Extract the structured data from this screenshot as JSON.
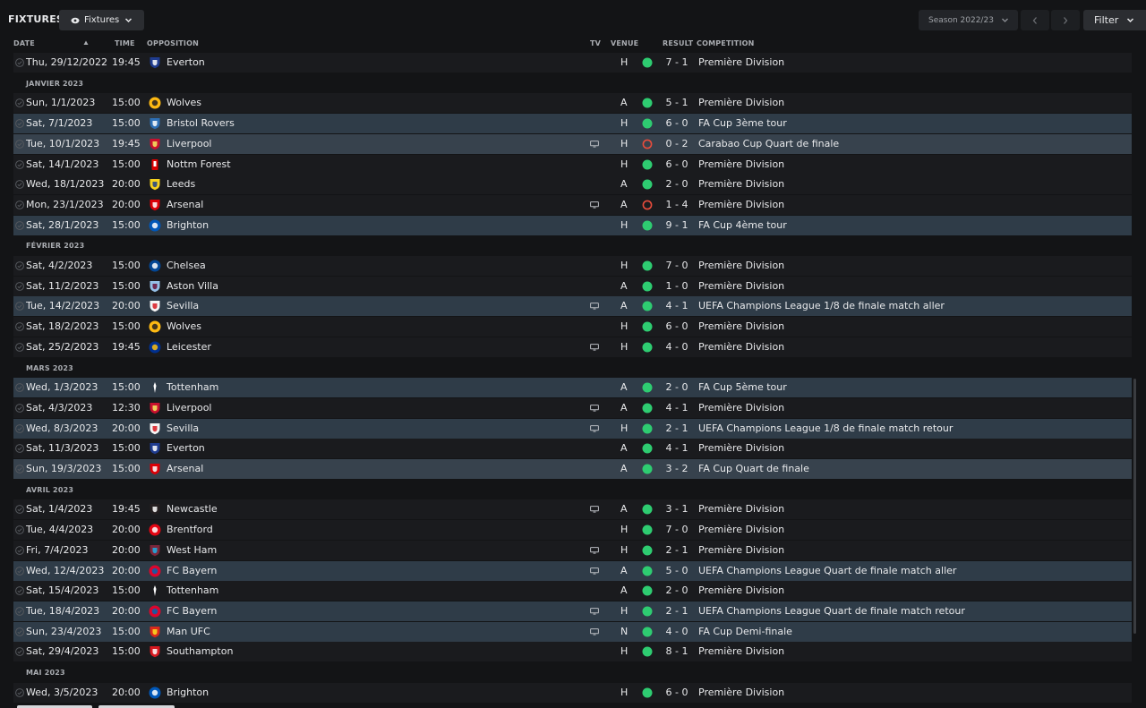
{
  "header": {
    "title": "FIXTURES",
    "view_label": "Fixtures",
    "season_label": "Season 2022/23",
    "filter_label": "Filter"
  },
  "columns": {
    "date": "DATE",
    "time": "TIME",
    "opposition": "OPPOSITION",
    "tv": "TV",
    "venue": "VENUE",
    "result": "RESULT",
    "competition": "COMPETITION"
  },
  "colors": {
    "win": "#2ecc71",
    "loss": "#e74c3c",
    "highlight_row": "#2f3c48",
    "selected_row": "#37424d"
  },
  "sections": [
    {
      "label": "JANVIER 2023"
    },
    {
      "label": "FÉVRIER 2023"
    },
    {
      "label": "MARS 2023"
    },
    {
      "label": "AVRIL 2023"
    },
    {
      "label": "MAI 2023"
    }
  ],
  "fixtures": [
    {
      "date": "Thu, 29/12/2022",
      "time": "19:45",
      "opp": "Everton",
      "crest": "everton-crest-icon",
      "tv": false,
      "venue": "H",
      "outcome": "win",
      "result": "7 - 1",
      "comp": "Première Division",
      "row": "normal"
    },
    {
      "date": "Sun, 1/1/2023",
      "time": "15:00",
      "opp": "Wolves",
      "crest": "wolves-crest-icon",
      "tv": false,
      "venue": "A",
      "outcome": "win",
      "result": "5 - 1",
      "comp": "Première Division",
      "row": "normal"
    },
    {
      "date": "Sat, 7/1/2023",
      "time": "15:00",
      "opp": "Bristol Rovers",
      "crest": "bristol-rovers-crest-icon",
      "tv": false,
      "venue": "H",
      "outcome": "win",
      "result": "6 - 0",
      "comp": "FA Cup 3ème tour",
      "row": "hl"
    },
    {
      "date": "Tue, 10/1/2023",
      "time": "19:45",
      "opp": "Liverpool",
      "crest": "liverpool-crest-icon",
      "tv": true,
      "venue": "H",
      "outcome": "loss",
      "result": "0 - 2",
      "comp": "Carabao Cup Quart de finale",
      "row": "sel"
    },
    {
      "date": "Sat, 14/1/2023",
      "time": "15:00",
      "opp": "Nottm Forest",
      "crest": "nottm-forest-crest-icon",
      "tv": false,
      "venue": "H",
      "outcome": "win",
      "result": "6 - 0",
      "comp": "Première Division",
      "row": "normal"
    },
    {
      "date": "Wed, 18/1/2023",
      "time": "20:00",
      "opp": "Leeds",
      "crest": "leeds-crest-icon",
      "tv": false,
      "venue": "A",
      "outcome": "win",
      "result": "2 - 0",
      "comp": "Première Division",
      "row": "normal"
    },
    {
      "date": "Mon, 23/1/2023",
      "time": "20:00",
      "opp": "Arsenal",
      "crest": "arsenal-crest-icon",
      "tv": true,
      "venue": "A",
      "outcome": "loss",
      "result": "1 - 4",
      "comp": "Première Division",
      "row": "normal"
    },
    {
      "date": "Sat, 28/1/2023",
      "time": "15:00",
      "opp": "Brighton",
      "crest": "brighton-crest-icon",
      "tv": false,
      "venue": "H",
      "outcome": "win",
      "result": "9 - 1",
      "comp": "FA Cup 4ème tour",
      "row": "hl"
    },
    {
      "date": "Sat, 4/2/2023",
      "time": "15:00",
      "opp": "Chelsea",
      "crest": "chelsea-crest-icon",
      "tv": false,
      "venue": "H",
      "outcome": "win",
      "result": "7 - 0",
      "comp": "Première Division",
      "row": "normal"
    },
    {
      "date": "Sat, 11/2/2023",
      "time": "15:00",
      "opp": "Aston Villa",
      "crest": "aston-villa-crest-icon",
      "tv": false,
      "venue": "A",
      "outcome": "win",
      "result": "1 - 0",
      "comp": "Première Division",
      "row": "normal"
    },
    {
      "date": "Tue, 14/2/2023",
      "time": "20:00",
      "opp": "Sevilla",
      "crest": "sevilla-crest-icon",
      "tv": true,
      "venue": "A",
      "outcome": "win",
      "result": "4 - 1",
      "comp": "UEFA Champions League 1/8 de finale match aller",
      "row": "hl"
    },
    {
      "date": "Sat, 18/2/2023",
      "time": "15:00",
      "opp": "Wolves",
      "crest": "wolves-crest-icon",
      "tv": false,
      "venue": "H",
      "outcome": "win",
      "result": "6 - 0",
      "comp": "Première Division",
      "row": "normal"
    },
    {
      "date": "Sat, 25/2/2023",
      "time": "19:45",
      "opp": "Leicester",
      "crest": "leicester-crest-icon",
      "tv": true,
      "venue": "H",
      "outcome": "win",
      "result": "4 - 0",
      "comp": "Première Division",
      "row": "normal"
    },
    {
      "date": "Wed, 1/3/2023",
      "time": "15:00",
      "opp": "Tottenham",
      "crest": "tottenham-crest-icon",
      "tv": false,
      "venue": "A",
      "outcome": "win",
      "result": "2 - 0",
      "comp": "FA Cup 5ème tour",
      "row": "hl"
    },
    {
      "date": "Sat, 4/3/2023",
      "time": "12:30",
      "opp": "Liverpool",
      "crest": "liverpool-crest-icon",
      "tv": true,
      "venue": "A",
      "outcome": "win",
      "result": "4 - 1",
      "comp": "Première Division",
      "row": "normal"
    },
    {
      "date": "Wed, 8/3/2023",
      "time": "20:00",
      "opp": "Sevilla",
      "crest": "sevilla-crest-icon",
      "tv": true,
      "venue": "H",
      "outcome": "win",
      "result": "2 - 1",
      "comp": "UEFA Champions League 1/8 de finale match retour",
      "row": "hl"
    },
    {
      "date": "Sat, 11/3/2023",
      "time": "15:00",
      "opp": "Everton",
      "crest": "everton-crest-icon",
      "tv": false,
      "venue": "A",
      "outcome": "win",
      "result": "4 - 1",
      "comp": "Première Division",
      "row": "normal"
    },
    {
      "date": "Sun, 19/3/2023",
      "time": "15:00",
      "opp": "Arsenal",
      "crest": "arsenal-crest-icon",
      "tv": false,
      "venue": "A",
      "outcome": "win",
      "result": "3 - 2",
      "comp": "FA Cup Quart de finale",
      "row": "sel"
    },
    {
      "date": "Sat, 1/4/2023",
      "time": "19:45",
      "opp": "Newcastle",
      "crest": "newcastle-crest-icon",
      "tv": true,
      "venue": "A",
      "outcome": "win",
      "result": "3 - 1",
      "comp": "Première Division",
      "row": "normal"
    },
    {
      "date": "Tue, 4/4/2023",
      "time": "20:00",
      "opp": "Brentford",
      "crest": "brentford-crest-icon",
      "tv": false,
      "venue": "H",
      "outcome": "win",
      "result": "7 - 0",
      "comp": "Première Division",
      "row": "normal"
    },
    {
      "date": "Fri, 7/4/2023",
      "time": "20:00",
      "opp": "West Ham",
      "crest": "west-ham-crest-icon",
      "tv": true,
      "venue": "H",
      "outcome": "win",
      "result": "2 - 1",
      "comp": "Première Division",
      "row": "normal"
    },
    {
      "date": "Wed, 12/4/2023",
      "time": "20:00",
      "opp": "FC Bayern",
      "crest": "fc-bayern-crest-icon",
      "tv": true,
      "venue": "A",
      "outcome": "win",
      "result": "5 - 0",
      "comp": "UEFA Champions League Quart de finale match aller",
      "row": "hl"
    },
    {
      "date": "Sat, 15/4/2023",
      "time": "15:00",
      "opp": "Tottenham",
      "crest": "tottenham-crest-icon",
      "tv": false,
      "venue": "A",
      "outcome": "win",
      "result": "2 - 0",
      "comp": "Première Division",
      "row": "normal"
    },
    {
      "date": "Tue, 18/4/2023",
      "time": "20:00",
      "opp": "FC Bayern",
      "crest": "fc-bayern-crest-icon",
      "tv": true,
      "venue": "H",
      "outcome": "win",
      "result": "2 - 1",
      "comp": "UEFA Champions League Quart de finale match retour",
      "row": "hl"
    },
    {
      "date": "Sun, 23/4/2023",
      "time": "15:00",
      "opp": "Man UFC",
      "crest": "man-ufc-crest-icon",
      "tv": true,
      "venue": "N",
      "outcome": "win",
      "result": "4 - 0",
      "comp": "FA Cup Demi-finale",
      "row": "hl"
    },
    {
      "date": "Sat, 29/4/2023",
      "time": "15:00",
      "opp": "Southampton",
      "crest": "southampton-crest-icon",
      "tv": false,
      "venue": "H",
      "outcome": "win",
      "result": "8 - 1",
      "comp": "Première Division",
      "row": "normal"
    },
    {
      "date": "Wed, 3/5/2023",
      "time": "20:00",
      "opp": "Brighton",
      "crest": "brighton-crest-icon",
      "tv": false,
      "venue": "H",
      "outcome": "win",
      "result": "6 - 0",
      "comp": "Première Division",
      "row": "normal"
    }
  ]
}
